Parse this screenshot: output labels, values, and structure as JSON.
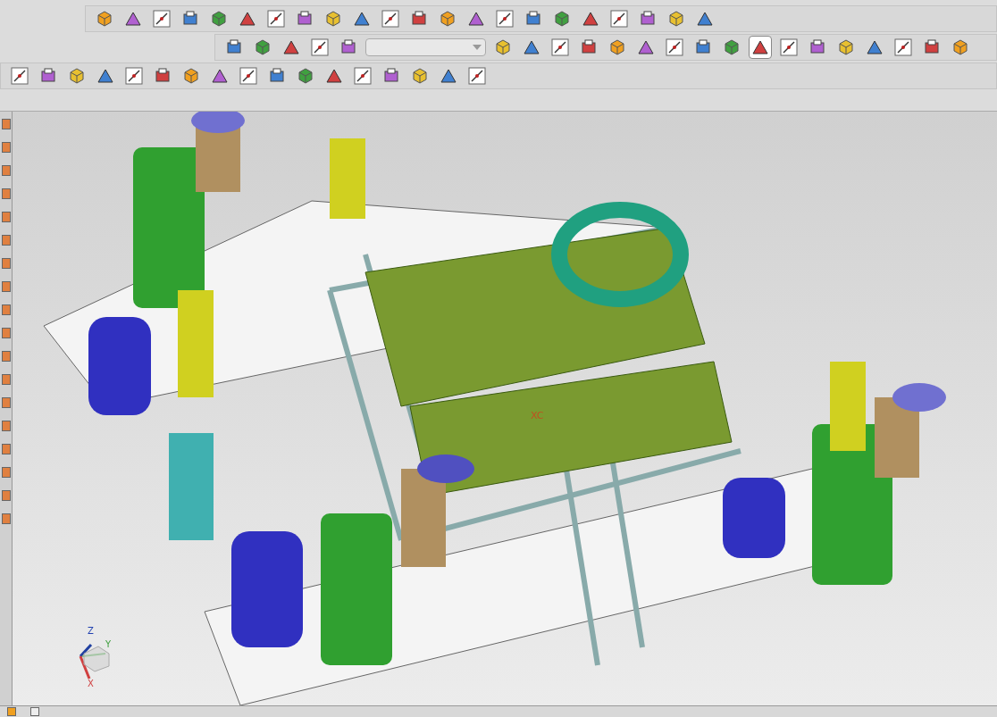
{
  "toolbars": [
    {
      "buttons": [
        {
          "selected": false
        },
        {
          "selected": false
        },
        {
          "selected": false
        },
        {
          "selected": false
        },
        {
          "selected": false
        },
        {
          "selected": false
        },
        {
          "selected": false
        },
        {
          "selected": false
        },
        {
          "selected": false
        },
        {
          "selected": false
        },
        {
          "selected": false
        },
        {
          "selected": false
        },
        {
          "selected": false
        },
        {
          "selected": false
        },
        {
          "selected": false
        },
        {
          "selected": false
        },
        {
          "selected": false
        },
        {
          "selected": false
        },
        {
          "selected": false
        },
        {
          "selected": false
        },
        {
          "selected": false
        },
        {
          "selected": false
        }
      ]
    },
    {
      "buttons": [
        {
          "selected": false
        },
        {
          "selected": false
        },
        {
          "selected": false
        },
        {
          "selected": false
        },
        {
          "selected": false
        },
        {
          "selected": false
        },
        {
          "selected": false
        },
        {
          "selected": false
        },
        {
          "selected": false
        },
        {
          "selected": false
        },
        {
          "selected": false
        },
        {
          "selected": false
        },
        {
          "selected": false
        },
        {
          "selected": false
        },
        {
          "selected": true
        },
        {
          "selected": false
        },
        {
          "selected": false
        },
        {
          "selected": false
        },
        {
          "selected": false
        },
        {
          "selected": false
        },
        {
          "selected": false
        },
        {
          "selected": false
        }
      ]
    },
    {
      "buttons": [
        {
          "selected": false
        },
        {
          "selected": false
        },
        {
          "selected": false
        },
        {
          "selected": false
        },
        {
          "selected": false
        },
        {
          "selected": false
        },
        {
          "selected": false
        },
        {
          "selected": false
        },
        {
          "selected": false
        },
        {
          "selected": false
        },
        {
          "selected": false
        },
        {
          "selected": false
        },
        {
          "selected": false
        },
        {
          "selected": false
        },
        {
          "selected": false
        },
        {
          "selected": false
        },
        {
          "selected": false
        }
      ]
    }
  ],
  "viewport": {
    "wcs_label": "XC",
    "triad": {
      "z": "Z",
      "y": "Y",
      "x": "X"
    }
  }
}
